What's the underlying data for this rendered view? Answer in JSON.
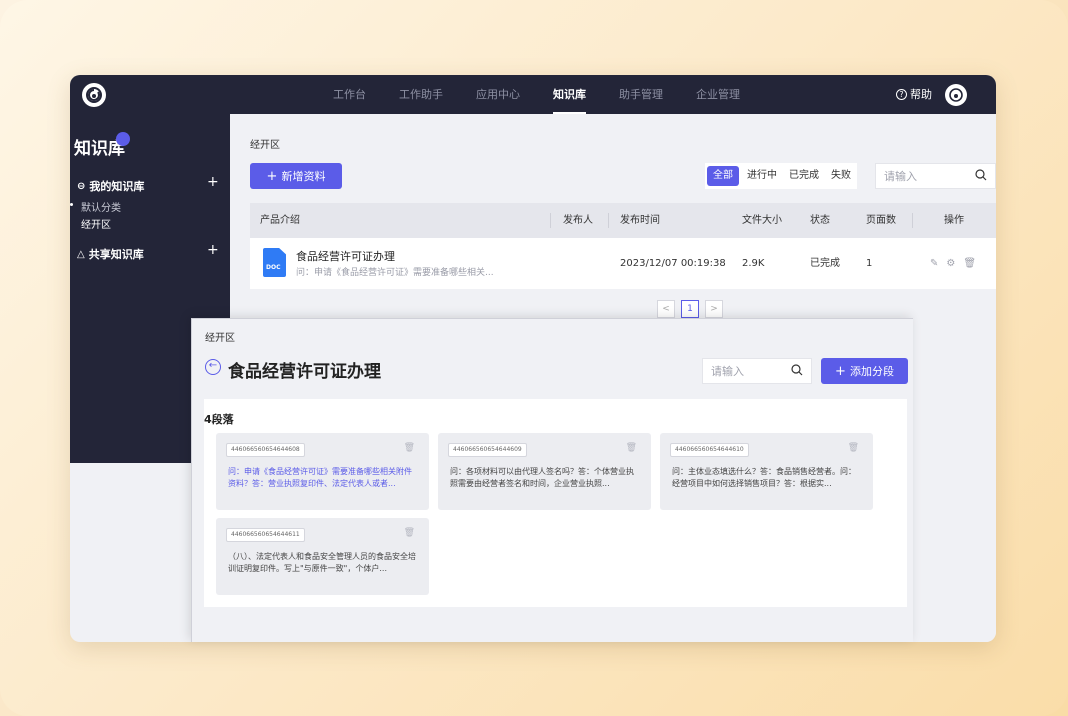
{
  "topbar": {
    "nav": [
      "工作台",
      "工作助手",
      "应用中心",
      "知识库",
      "助手管理",
      "企业管理"
    ],
    "active_nav": "知识库",
    "help_label": "帮助"
  },
  "sidebar": {
    "title": "知识库",
    "my_kb": "我的知识库",
    "sub_items": [
      "默认分类",
      "经开区"
    ],
    "shared_kb": "共享知识库"
  },
  "main": {
    "breadcrumb": "经开区",
    "add_button": "新增资料",
    "filters": [
      "全部",
      "进行中",
      "已完成",
      "失败"
    ],
    "active_filter": "全部",
    "search_placeholder": "请输入",
    "columns": [
      "产品介绍",
      "发布人",
      "发布时间",
      "文件大小",
      "状态",
      "页面数",
      "操作"
    ],
    "rows": [
      {
        "file_type": "DOC",
        "name": "食品经营许可证办理",
        "desc": "问：申请《食品经营许可证》需要准备哪些相关...",
        "publisher": "",
        "time": "2023/12/07 00:19:38",
        "size": "2.9K",
        "status": "已完成",
        "pages": "1"
      }
    ],
    "pagination": {
      "current": "1",
      "prev": "<",
      "next": ">"
    }
  },
  "detail": {
    "breadcrumb": "经开区",
    "title": "食品经营许可证办理",
    "search_placeholder": "请输入",
    "add_button": "添加分段",
    "count_label": "4段落",
    "segments": [
      {
        "id": "446066560654644608",
        "text": "问：申请《食品经营许可证》需要准备哪些相关附件资料？答：营业执照复印件、法定代表人或者...",
        "highlight": true
      },
      {
        "id": "446066560654644609",
        "text": "问：各项材料可以由代理人签名吗？答：个体营业执照需要由经营者签名和时间，企业营业执照...",
        "highlight": false
      },
      {
        "id": "446066560654644610",
        "text": "问：主体业态填选什么？答：食品销售经营者。问：经营项目中如何选择销售项目？答：根据实...",
        "highlight": false
      },
      {
        "id": "446066560654644611",
        "text": "（八）、法定代表人和食品安全管理人员的食品安全培训证明复印件。写上\"与原件一致\"，个体户...",
        "highlight": false
      }
    ]
  },
  "colors": {
    "accent": "#5b5ce8",
    "nav_bg": "#232538",
    "doc_blue": "#2f7bf5"
  }
}
